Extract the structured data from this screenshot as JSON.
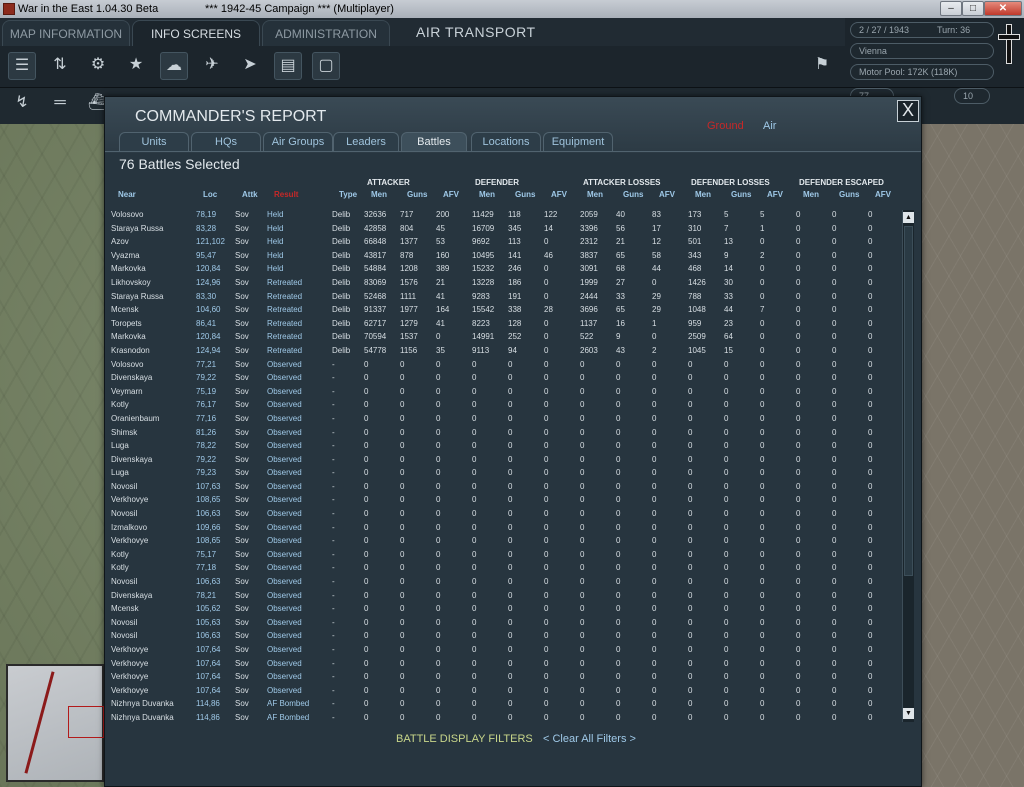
{
  "window": {
    "title": "War in the East 1.04.30 Beta",
    "campaign": "***    1942-45 Campaign    ***   (Multiplayer)"
  },
  "top_tabs": [
    {
      "label": "MAP INFORMATION"
    },
    {
      "label": "INFO SCREENS"
    },
    {
      "label": "ADMINISTRATION"
    }
  ],
  "mode_title": "AIR TRANSPORT",
  "status": {
    "date": "2 / 27 / 1943",
    "turn": "Turn: 36",
    "location": "Vienna",
    "motor_pool": "Motor Pool:  172K (118K)",
    "count": "77",
    "counter_box": "10"
  },
  "report": {
    "title": "COMMANDER'S REPORT",
    "mode_ground": "Ground",
    "mode_air": "Air",
    "close": "X",
    "tabs": [
      "Units",
      "HQs",
      "Air Groups",
      "Leaders",
      "Battles",
      "Locations",
      "Equipment"
    ],
    "selected_count": "76 Battles Selected",
    "groups": [
      "ATTACKER",
      "DEFENDER",
      "ATTACKER LOSSES",
      "DEFENDER LOSSES",
      "DEFENDER ESCAPED"
    ],
    "columns": [
      "Near",
      "Loc",
      "Attk",
      "Result",
      "Type",
      "Men",
      "Guns",
      "AFV",
      "Men",
      "Guns",
      "AFV",
      "Men",
      "Guns",
      "AFV",
      "Men",
      "Guns",
      "AFV",
      "Men",
      "Guns",
      "AFV"
    ],
    "rows": [
      [
        "Volosovo",
        "78,19",
        "Sov",
        "Held",
        "Delib",
        "32636",
        "717",
        "200",
        "11429",
        "118",
        "122",
        "2059",
        "40",
        "83",
        "173",
        "5",
        "5",
        "0",
        "0",
        "0"
      ],
      [
        "Staraya Russa",
        "83,28",
        "Sov",
        "Held",
        "Delib",
        "42858",
        "804",
        "45",
        "16709",
        "345",
        "14",
        "3396",
        "56",
        "17",
        "310",
        "7",
        "1",
        "0",
        "0",
        "0"
      ],
      [
        "Azov",
        "121,102",
        "Sov",
        "Held",
        "Delib",
        "66848",
        "1377",
        "53",
        "9692",
        "113",
        "0",
        "2312",
        "21",
        "12",
        "501",
        "13",
        "0",
        "0",
        "0",
        "0"
      ],
      [
        "Vyazma",
        "95,47",
        "Sov",
        "Held",
        "Delib",
        "43817",
        "878",
        "160",
        "10495",
        "141",
        "46",
        "3837",
        "65",
        "58",
        "343",
        "9",
        "2",
        "0",
        "0",
        "0"
      ],
      [
        "Markovka",
        "120,84",
        "Sov",
        "Held",
        "Delib",
        "54884",
        "1208",
        "389",
        "15232",
        "246",
        "0",
        "3091",
        "68",
        "44",
        "468",
        "14",
        "0",
        "0",
        "0",
        "0"
      ],
      [
        "Likhovskoy",
        "124,96",
        "Sov",
        "Retreated",
        "Delib",
        "83069",
        "1576",
        "21",
        "13228",
        "186",
        "0",
        "1999",
        "27",
        "0",
        "1426",
        "30",
        "0",
        "0",
        "0",
        "0"
      ],
      [
        "Staraya Russa",
        "83,30",
        "Sov",
        "Retreated",
        "Delib",
        "52468",
        "1111",
        "41",
        "9283",
        "191",
        "0",
        "2444",
        "33",
        "29",
        "788",
        "33",
        "0",
        "0",
        "0",
        "0"
      ],
      [
        "Mcensk",
        "104,60",
        "Sov",
        "Retreated",
        "Delib",
        "91337",
        "1977",
        "164",
        "15542",
        "338",
        "28",
        "3696",
        "65",
        "29",
        "1048",
        "44",
        "7",
        "0",
        "0",
        "0"
      ],
      [
        "Toropets",
        "86,41",
        "Sov",
        "Retreated",
        "Delib",
        "62717",
        "1279",
        "41",
        "8223",
        "128",
        "0",
        "1137",
        "16",
        "1",
        "959",
        "23",
        "0",
        "0",
        "0",
        "0"
      ],
      [
        "Markovka",
        "120,84",
        "Sov",
        "Retreated",
        "Delib",
        "70594",
        "1537",
        "0",
        "14991",
        "252",
        "0",
        "522",
        "9",
        "0",
        "2509",
        "64",
        "0",
        "0",
        "0",
        "0"
      ],
      [
        "Krasnodon",
        "124,94",
        "Sov",
        "Retreated",
        "Delib",
        "54778",
        "1156",
        "35",
        "9113",
        "94",
        "0",
        "2603",
        "43",
        "2",
        "1045",
        "15",
        "0",
        "0",
        "0",
        "0"
      ],
      [
        "Volosovo",
        "77,21",
        "Sov",
        "Observed",
        "-",
        "0",
        "0",
        "0",
        "0",
        "0",
        "0",
        "0",
        "0",
        "0",
        "0",
        "0",
        "0",
        "0",
        "0",
        "0"
      ],
      [
        "Divenskaya",
        "79,22",
        "Sov",
        "Observed",
        "-",
        "0",
        "0",
        "0",
        "0",
        "0",
        "0",
        "0",
        "0",
        "0",
        "0",
        "0",
        "0",
        "0",
        "0",
        "0"
      ],
      [
        "Veymarn",
        "75,19",
        "Sov",
        "Observed",
        "-",
        "0",
        "0",
        "0",
        "0",
        "0",
        "0",
        "0",
        "0",
        "0",
        "0",
        "0",
        "0",
        "0",
        "0",
        "0"
      ],
      [
        "Kotly",
        "76,17",
        "Sov",
        "Observed",
        "-",
        "0",
        "0",
        "0",
        "0",
        "0",
        "0",
        "0",
        "0",
        "0",
        "0",
        "0",
        "0",
        "0",
        "0",
        "0"
      ],
      [
        "Oranienbaum",
        "77,16",
        "Sov",
        "Observed",
        "-",
        "0",
        "0",
        "0",
        "0",
        "0",
        "0",
        "0",
        "0",
        "0",
        "0",
        "0",
        "0",
        "0",
        "0",
        "0"
      ],
      [
        "Shimsk",
        "81,26",
        "Sov",
        "Observed",
        "-",
        "0",
        "0",
        "0",
        "0",
        "0",
        "0",
        "0",
        "0",
        "0",
        "0",
        "0",
        "0",
        "0",
        "0",
        "0"
      ],
      [
        "Luga",
        "78,22",
        "Sov",
        "Observed",
        "-",
        "0",
        "0",
        "0",
        "0",
        "0",
        "0",
        "0",
        "0",
        "0",
        "0",
        "0",
        "0",
        "0",
        "0",
        "0"
      ],
      [
        "Divenskaya",
        "79,22",
        "Sov",
        "Observed",
        "-",
        "0",
        "0",
        "0",
        "0",
        "0",
        "0",
        "0",
        "0",
        "0",
        "0",
        "0",
        "0",
        "0",
        "0",
        "0"
      ],
      [
        "Luga",
        "79,23",
        "Sov",
        "Observed",
        "-",
        "0",
        "0",
        "0",
        "0",
        "0",
        "0",
        "0",
        "0",
        "0",
        "0",
        "0",
        "0",
        "0",
        "0",
        "0"
      ],
      [
        "Novosil",
        "107,63",
        "Sov",
        "Observed",
        "-",
        "0",
        "0",
        "0",
        "0",
        "0",
        "0",
        "0",
        "0",
        "0",
        "0",
        "0",
        "0",
        "0",
        "0",
        "0"
      ],
      [
        "Verkhovye",
        "108,65",
        "Sov",
        "Observed",
        "-",
        "0",
        "0",
        "0",
        "0",
        "0",
        "0",
        "0",
        "0",
        "0",
        "0",
        "0",
        "0",
        "0",
        "0",
        "0"
      ],
      [
        "Novosil",
        "106,63",
        "Sov",
        "Observed",
        "-",
        "0",
        "0",
        "0",
        "0",
        "0",
        "0",
        "0",
        "0",
        "0",
        "0",
        "0",
        "0",
        "0",
        "0",
        "0"
      ],
      [
        "Izmalkovo",
        "109,66",
        "Sov",
        "Observed",
        "-",
        "0",
        "0",
        "0",
        "0",
        "0",
        "0",
        "0",
        "0",
        "0",
        "0",
        "0",
        "0",
        "0",
        "0",
        "0"
      ],
      [
        "Verkhovye",
        "108,65",
        "Sov",
        "Observed",
        "-",
        "0",
        "0",
        "0",
        "0",
        "0",
        "0",
        "0",
        "0",
        "0",
        "0",
        "0",
        "0",
        "0",
        "0",
        "0"
      ],
      [
        "Kotly",
        "75,17",
        "Sov",
        "Observed",
        "-",
        "0",
        "0",
        "0",
        "0",
        "0",
        "0",
        "0",
        "0",
        "0",
        "0",
        "0",
        "0",
        "0",
        "0",
        "0"
      ],
      [
        "Kotly",
        "77,18",
        "Sov",
        "Observed",
        "-",
        "0",
        "0",
        "0",
        "0",
        "0",
        "0",
        "0",
        "0",
        "0",
        "0",
        "0",
        "0",
        "0",
        "0",
        "0"
      ],
      [
        "Novosil",
        "106,63",
        "Sov",
        "Observed",
        "-",
        "0",
        "0",
        "0",
        "0",
        "0",
        "0",
        "0",
        "0",
        "0",
        "0",
        "0",
        "0",
        "0",
        "0",
        "0"
      ],
      [
        "Divenskaya",
        "78,21",
        "Sov",
        "Observed",
        "-",
        "0",
        "0",
        "0",
        "0",
        "0",
        "0",
        "0",
        "0",
        "0",
        "0",
        "0",
        "0",
        "0",
        "0",
        "0"
      ],
      [
        "Mcensk",
        "105,62",
        "Sov",
        "Observed",
        "-",
        "0",
        "0",
        "0",
        "0",
        "0",
        "0",
        "0",
        "0",
        "0",
        "0",
        "0",
        "0",
        "0",
        "0",
        "0"
      ],
      [
        "Novosil",
        "105,63",
        "Sov",
        "Observed",
        "-",
        "0",
        "0",
        "0",
        "0",
        "0",
        "0",
        "0",
        "0",
        "0",
        "0",
        "0",
        "0",
        "0",
        "0",
        "0"
      ],
      [
        "Novosil",
        "106,63",
        "Sov",
        "Observed",
        "-",
        "0",
        "0",
        "0",
        "0",
        "0",
        "0",
        "0",
        "0",
        "0",
        "0",
        "0",
        "0",
        "0",
        "0",
        "0"
      ],
      [
        "Verkhovye",
        "107,64",
        "Sov",
        "Observed",
        "-",
        "0",
        "0",
        "0",
        "0",
        "0",
        "0",
        "0",
        "0",
        "0",
        "0",
        "0",
        "0",
        "0",
        "0",
        "0"
      ],
      [
        "Verkhovye",
        "107,64",
        "Sov",
        "Observed",
        "-",
        "0",
        "0",
        "0",
        "0",
        "0",
        "0",
        "0",
        "0",
        "0",
        "0",
        "0",
        "0",
        "0",
        "0",
        "0"
      ],
      [
        "Verkhovye",
        "107,64",
        "Sov",
        "Observed",
        "-",
        "0",
        "0",
        "0",
        "0",
        "0",
        "0",
        "0",
        "0",
        "0",
        "0",
        "0",
        "0",
        "0",
        "0",
        "0"
      ],
      [
        "Verkhovye",
        "107,64",
        "Sov",
        "Observed",
        "-",
        "0",
        "0",
        "0",
        "0",
        "0",
        "0",
        "0",
        "0",
        "0",
        "0",
        "0",
        "0",
        "0",
        "0",
        "0"
      ],
      [
        "Nizhnya Duvanka",
        "114,86",
        "Sov",
        "AF Bombed",
        "-",
        "0",
        "0",
        "0",
        "0",
        "0",
        "0",
        "0",
        "0",
        "0",
        "0",
        "0",
        "0",
        "0",
        "0",
        "0"
      ],
      [
        "Nizhnya Duvanka",
        "114,86",
        "Sov",
        "AF Bombed",
        "-",
        "0",
        "0",
        "0",
        "0",
        "0",
        "0",
        "0",
        "0",
        "0",
        "0",
        "0",
        "0",
        "0",
        "0",
        "0"
      ]
    ],
    "filters_label": "BATTLE DISPLAY FILTERS",
    "clear_label": "< Clear All Filters >"
  }
}
